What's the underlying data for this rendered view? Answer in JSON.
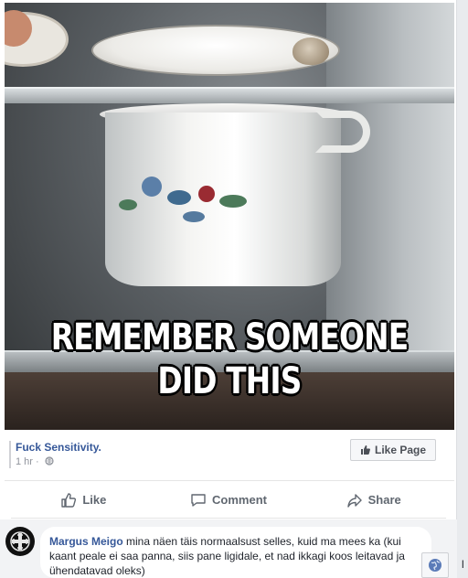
{
  "post": {
    "image_caption_line1": "REMEMBER SOMEONE",
    "image_caption_line2": "DID THIS",
    "source_name": "Fuck Sensitivity.",
    "timestamp": "1 hr",
    "separator": "·",
    "audience_icon": "public-globe-icon",
    "like_page_label": "Like Page"
  },
  "actions": {
    "like_label": "Like",
    "comment_label": "Comment",
    "share_label": "Share"
  },
  "comment": {
    "author": "Margus Meigo",
    "text": "mina näen täis normaalsust selles, kuid ma mees ka (kui kaant peale ei saa panna, siis pane ligidale, et nad ikkagi koos leitavad ja ühendatavad oleks)"
  },
  "edge": {
    "cut_char": "l"
  },
  "colors": {
    "link_blue": "#365899",
    "action_gray": "#606770",
    "meta_gray": "#90949c",
    "background": "#e9ebee"
  }
}
